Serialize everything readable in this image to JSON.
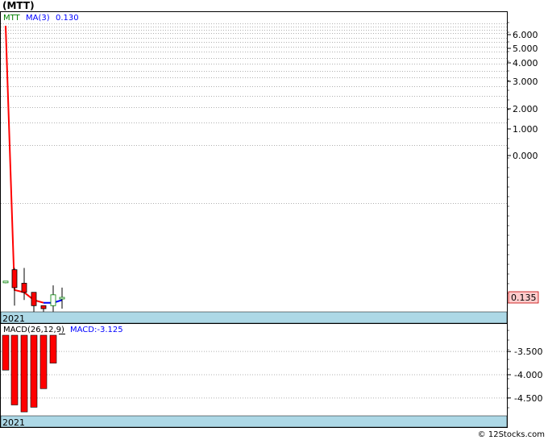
{
  "title": "(MTT)",
  "watermark": "© 12Stocks.com",
  "colors": {
    "up": "#008000",
    "down": "#ff0000",
    "ma": "#0000ff",
    "year_band": "#add8e6",
    "grid": "#c0c0c0",
    "price_tag_bg": "#ffcccc"
  },
  "price_panel": {
    "legend": {
      "ticker": "MTT",
      "ma_label": "MA(3)",
      "ma_value": "0.130"
    },
    "y_ticks": [
      "6.000",
      "5.000",
      "4.000",
      "3.000",
      "2.000",
      "1.000",
      "0.000"
    ],
    "last_price": "0.135",
    "year_label": "2021"
  },
  "macd_panel": {
    "legend": {
      "name": "MACD(26,12,9)",
      "value": "MACD:-3.125"
    },
    "y_ticks": [
      "-3.500",
      "-4.000",
      "-4.500"
    ],
    "year_label": "2021"
  },
  "chart_data": [
    {
      "type": "candlestick",
      "ticker": "MTT",
      "scale": "log",
      "candles": [
        {
          "open": 0.17,
          "high": 0.17,
          "low": 0.165,
          "close": 0.17
        },
        {
          "open": 0.2,
          "high": 0.205,
          "low": 0.12,
          "close": 0.155
        },
        {
          "open": 0.165,
          "high": 0.205,
          "low": 0.13,
          "close": 0.145
        },
        {
          "open": 0.145,
          "high": 0.145,
          "low": 0.1,
          "close": 0.12
        },
        {
          "open": 0.12,
          "high": 0.12,
          "low": 0.11,
          "close": 0.115
        },
        {
          "open": 0.12,
          "high": 0.16,
          "low": 0.11,
          "close": 0.14
        },
        {
          "open": 0.135,
          "high": 0.155,
          "low": 0.115,
          "close": 0.135
        }
      ],
      "ma3": [
        6.4,
        0.15,
        0.145,
        0.13,
        0.125,
        0.125,
        0.13
      ],
      "last": 0.135
    },
    {
      "type": "bar",
      "name": "MACD(26,12,9)",
      "values": [
        -3.9,
        -4.65,
        -4.8,
        -4.7,
        -4.3,
        -3.75,
        -3.125
      ],
      "ylim": [
        -4.85,
        -3.15
      ]
    }
  ]
}
